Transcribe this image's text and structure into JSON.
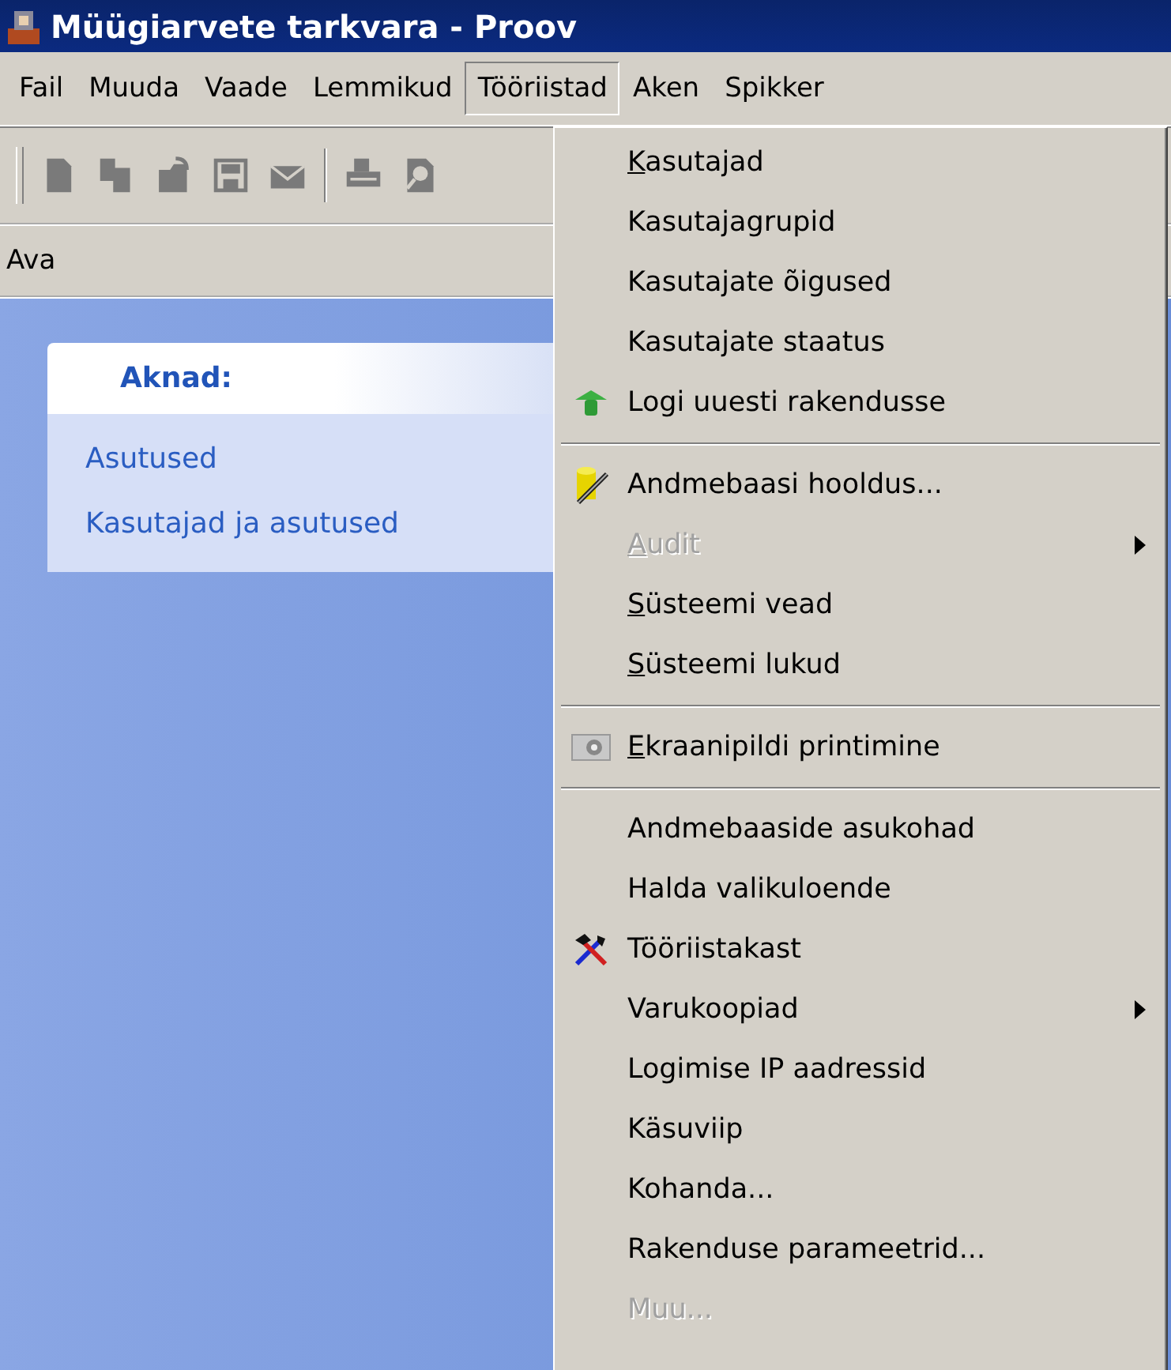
{
  "window": {
    "title": "Müügiarvete tarkvara - Proov"
  },
  "menubar": [
    {
      "label": "Fail",
      "selected": false
    },
    {
      "label": "Muuda",
      "selected": false
    },
    {
      "label": "Vaade",
      "selected": false
    },
    {
      "label": "Lemmikud",
      "selected": false
    },
    {
      "label": "Tööriistad",
      "selected": true
    },
    {
      "label": "Aken",
      "selected": false
    },
    {
      "label": "Spikker",
      "selected": false
    }
  ],
  "action_bar": {
    "label": "Ava"
  },
  "panel": {
    "title": "Aknad:",
    "links": [
      "Asutused",
      "Kasutajad ja asutused"
    ]
  },
  "menu": [
    {
      "kind": "item",
      "label": "Kasutajad",
      "underlined_first_letter": true,
      "disabled": false,
      "submenu": false
    },
    {
      "kind": "item",
      "label": "Kasutajagrupid",
      "underlined_first_letter": false,
      "disabled": false,
      "submenu": false
    },
    {
      "kind": "item",
      "label": "Kasutajate õigused",
      "underlined_first_letter": false,
      "disabled": false,
      "submenu": false
    },
    {
      "kind": "item",
      "label": "Kasutajate staatus",
      "underlined_first_letter": false,
      "disabled": false,
      "submenu": false
    },
    {
      "kind": "item",
      "label": "Logi uuesti rakendusse",
      "underlined_first_letter": false,
      "disabled": false,
      "submenu": false
    },
    {
      "kind": "separator"
    },
    {
      "kind": "item",
      "label": "Andmebaasi hooldus...",
      "underlined_first_letter": false,
      "disabled": false,
      "submenu": false
    },
    {
      "kind": "item",
      "label": "Audit",
      "underlined_first_letter": true,
      "disabled": true,
      "submenu": true
    },
    {
      "kind": "item",
      "label": "Süsteemi vead",
      "underlined_first_letter": true,
      "disabled": false,
      "submenu": false
    },
    {
      "kind": "item",
      "label": "Süsteemi lukud",
      "underlined_first_letter": true,
      "disabled": false,
      "submenu": false
    },
    {
      "kind": "separator"
    },
    {
      "kind": "item",
      "label": "Ekraanipildi printimine",
      "underlined_first_letter": true,
      "disabled": false,
      "submenu": false
    },
    {
      "kind": "separator"
    },
    {
      "kind": "item",
      "label": "Andmebaaside asukohad",
      "underlined_first_letter": false,
      "disabled": false,
      "submenu": false
    },
    {
      "kind": "item",
      "label": "Halda valikuloende",
      "underlined_first_letter": false,
      "disabled": false,
      "submenu": false
    },
    {
      "kind": "item",
      "label": "Tööriistakast",
      "underlined_first_letter": false,
      "disabled": false,
      "submenu": false
    },
    {
      "kind": "item",
      "label": "Varukoopiad",
      "underlined_first_letter": false,
      "disabled": false,
      "submenu": true
    },
    {
      "kind": "item",
      "label": "Logimise IP aadressid",
      "underlined_first_letter": false,
      "disabled": false,
      "submenu": false
    },
    {
      "kind": "item",
      "label": "Käsuviip",
      "underlined_first_letter": false,
      "disabled": false,
      "submenu": false
    },
    {
      "kind": "item",
      "label": "Kohanda...",
      "underlined_first_letter": false,
      "disabled": false,
      "submenu": false
    },
    {
      "kind": "item",
      "label": "Rakenduse parameetrid...",
      "underlined_first_letter": false,
      "disabled": false,
      "submenu": false
    },
    {
      "kind": "item",
      "label": "Muu...",
      "underlined_first_letter": false,
      "disabled": true,
      "submenu": false
    }
  ]
}
